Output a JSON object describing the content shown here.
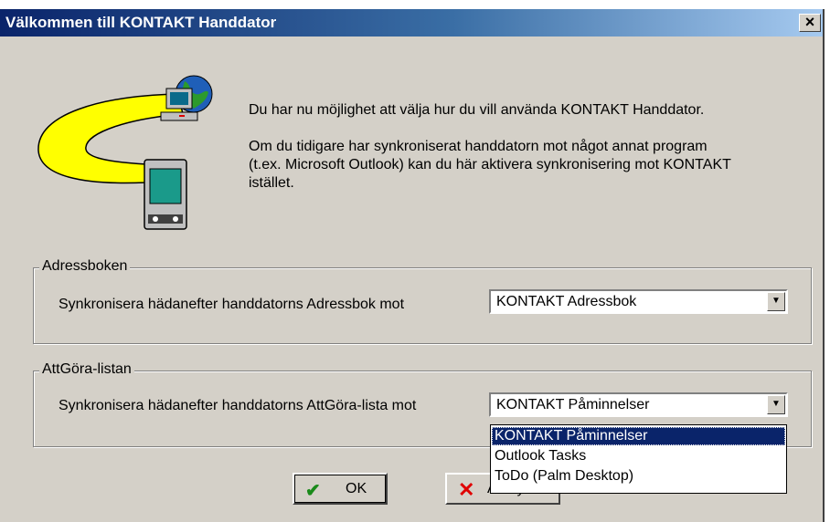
{
  "window": {
    "title": "Välkommen till KONTAKT Handdator",
    "close_label": "×"
  },
  "intro": {
    "line1": "Du har nu möjlighet att välja hur du vill använda KONTAKT Handdator.",
    "para2_l1": "Om du tidigare har synkroniserat handdatorn mot något annat program",
    "para2_l2": "(t.ex. Microsoft Outlook) kan du här aktivera synkronisering mot KONTAKT",
    "para2_l3": "istället."
  },
  "address_group": {
    "legend": "Adressboken",
    "label": "Synkronisera hädanefter handdatorns Adressbok mot",
    "selected": "KONTAKT Adressbok"
  },
  "todo_group": {
    "legend": "AttGöra-listan",
    "label": "Synkronisera hädanefter handdatorns AttGöra-lista mot",
    "selected": "KONTAKT Påminnelser",
    "options": [
      "KONTAKT Påminnelser",
      "Outlook Tasks",
      "ToDo (Palm Desktop)"
    ]
  },
  "buttons": {
    "ok": "OK",
    "cancel": "Avbryt"
  },
  "icons": {
    "ok": "checkmark-icon",
    "cancel": "x-cross-icon",
    "dropdown": "chevron-down-icon"
  },
  "colors": {
    "title_start": "#0a246a",
    "title_end": "#a6caf0",
    "face": "#d4d0c8",
    "selection": "#0a246a"
  }
}
